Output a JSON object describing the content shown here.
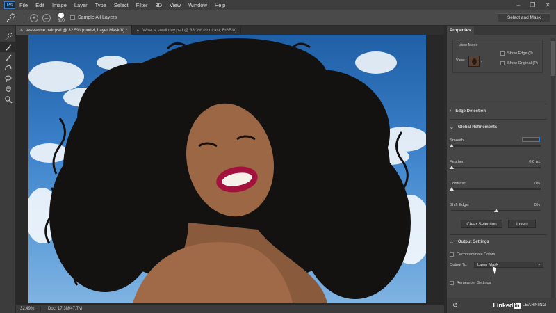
{
  "menubar": {
    "logo": "Ps",
    "items": [
      "File",
      "Edit",
      "Image",
      "Layer",
      "Type",
      "Select",
      "Filter",
      "3D",
      "View",
      "Window",
      "Help"
    ],
    "window_controls": [
      "–",
      "❐",
      "✕"
    ]
  },
  "options": {
    "brush_size": "800",
    "sample_all_layers": "Sample All Layers",
    "select_and_mask": "Select and Mask"
  },
  "tabs": [
    {
      "label": "Awesome hair.psd @ 32.5% (model, Layer Mask/8) *",
      "close": "×",
      "active": true
    },
    {
      "label": "What a swell day.psd @ 33.3% (contrast, RGB/8)",
      "close": "×",
      "active": false
    }
  ],
  "status": {
    "zoom": "32.49%",
    "doc": "Doc: 17.3M/47.7M"
  },
  "panel": {
    "tab": "Properties",
    "view_mode": {
      "title": "View Mode",
      "view_label": "View:",
      "show_edge": "Show Edge (J)",
      "show_original": "Show Original (P)"
    },
    "edge_detection": "Edge Detection",
    "global_refinements": {
      "title": "Global Refinements",
      "smooth_label": "Smooth:",
      "smooth_value": "0",
      "feather_label": "Feather:",
      "feather_value": "0.0 px",
      "contrast_label": "Contrast:",
      "contrast_value": "0%",
      "shift_edge_label": "Shift Edge:",
      "shift_edge_value": "0%"
    },
    "clear_selection": "Clear Selection",
    "invert": "Invert",
    "output_settings": {
      "title": "Output Settings",
      "decontaminate": "Decontaminate Colors",
      "output_to_label": "Output To:",
      "output_to_value": "Layer Mask",
      "remember": "Remember Settings"
    },
    "footer": {
      "brand": "Linked",
      "brand_in": "in",
      "learning": "LEARNING"
    }
  },
  "colors": {
    "accent_blue": "#2e7bd6",
    "lips": "#a3123f"
  }
}
